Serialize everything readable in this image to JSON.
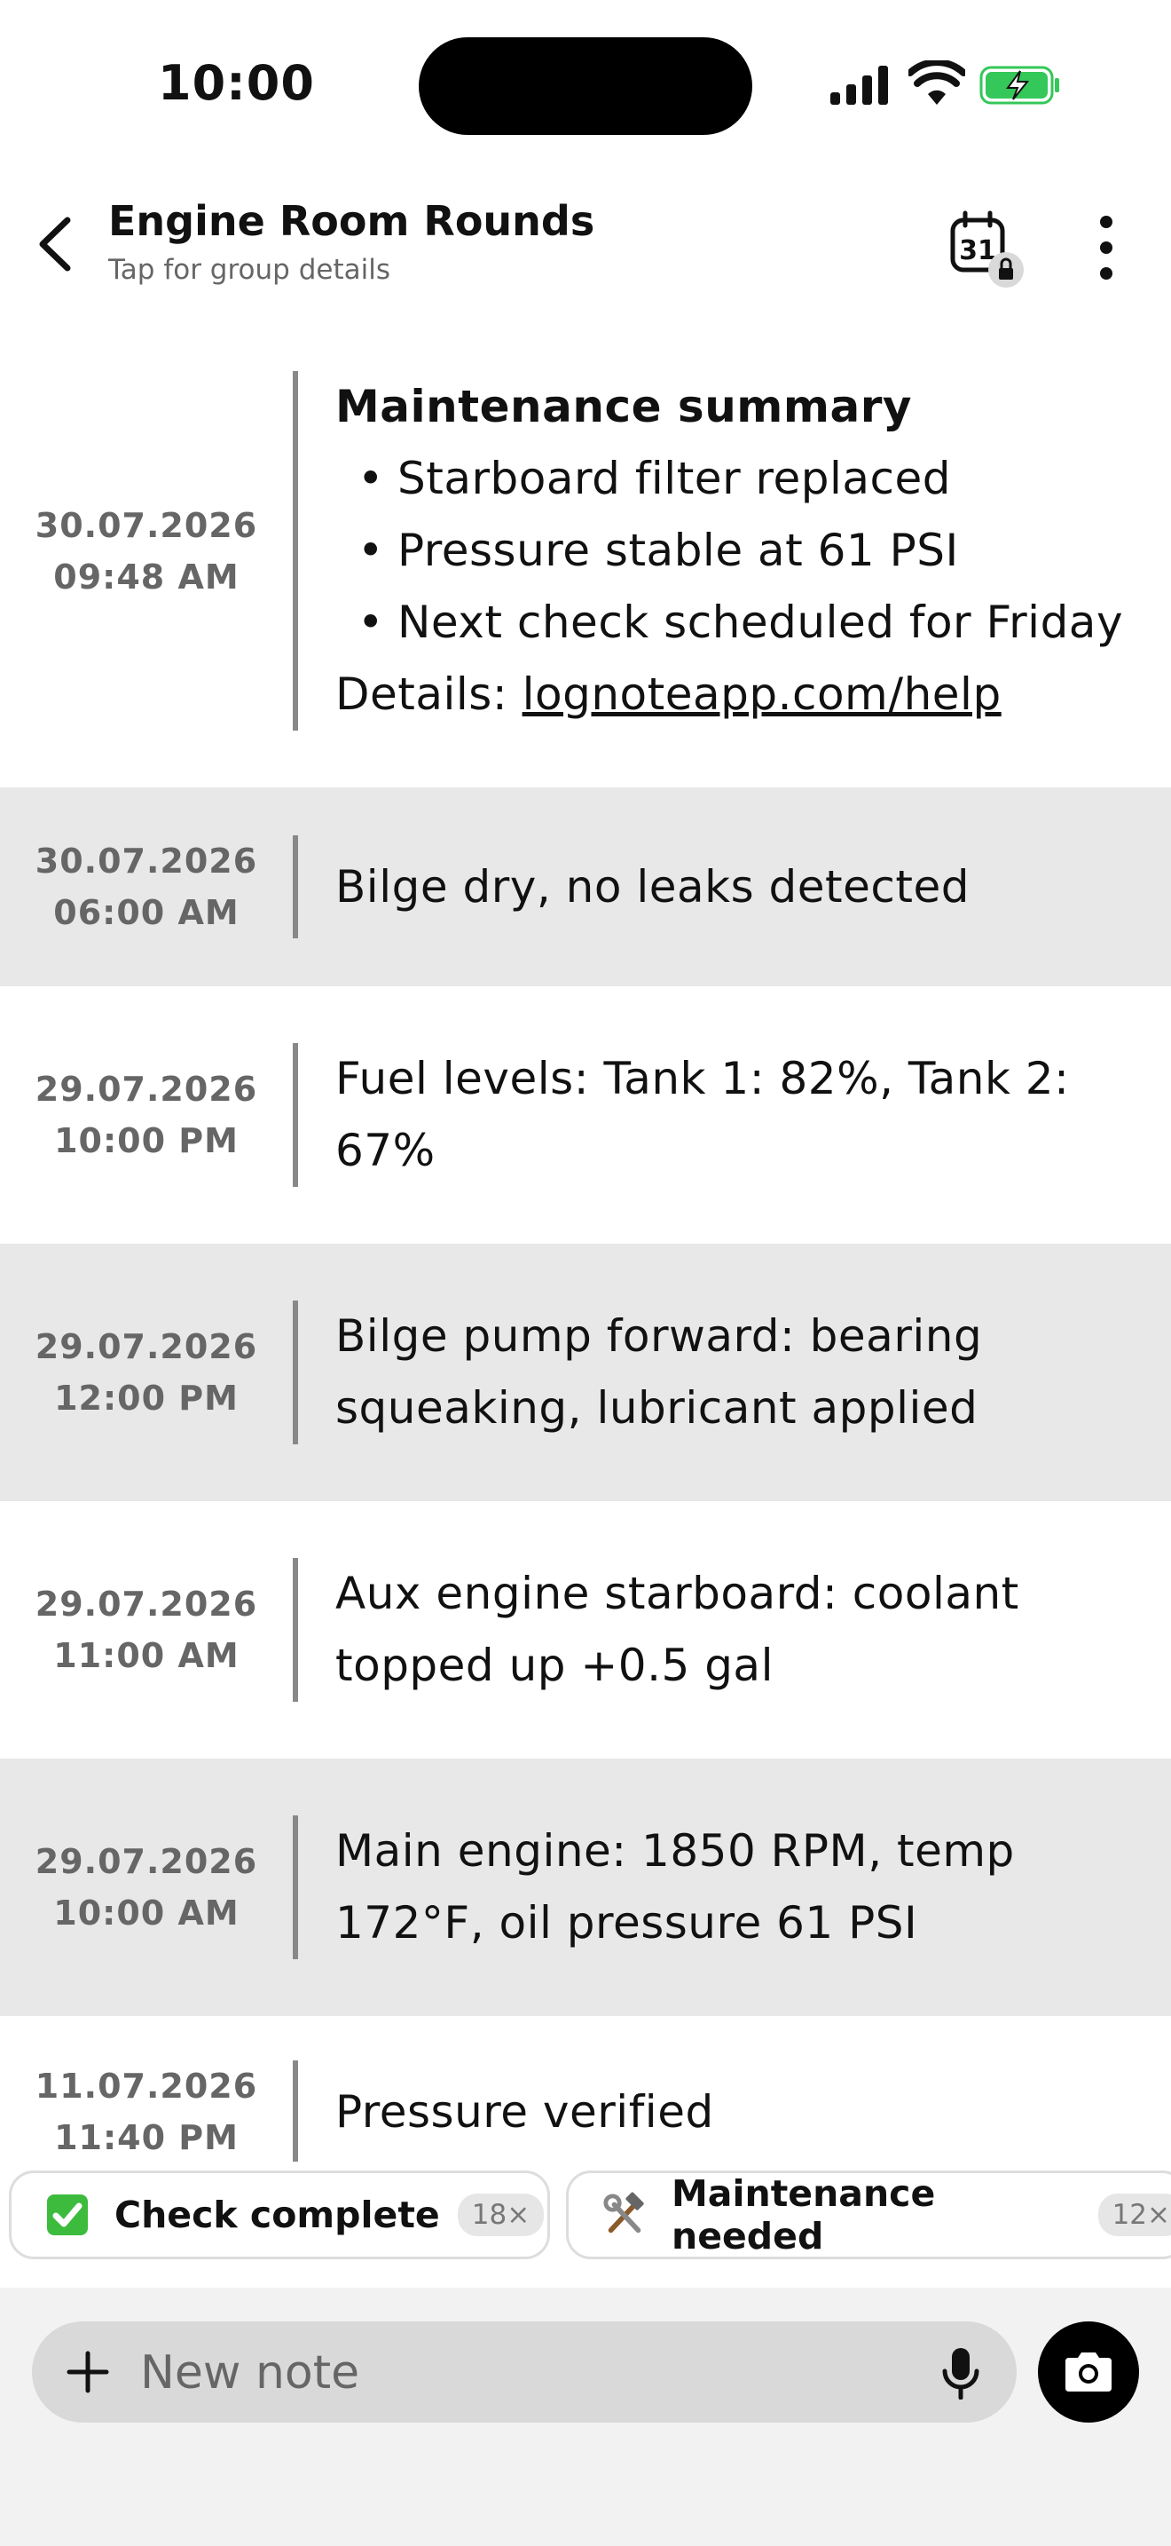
{
  "status_bar": {
    "time": "10:00"
  },
  "header": {
    "title": "Engine Room Rounds",
    "subtitle": "Tap for group details",
    "calendar_day": "31"
  },
  "notes": [
    {
      "date": "30.07.2026",
      "time": "09:48 AM",
      "summary_title": "Maintenance summary",
      "bullets": [
        "Starboard filter replaced",
        "Pressure stable at 61 PSI",
        "Next check scheduled for Friday"
      ],
      "details_label": "Details:",
      "details_link": "lognoteapp.com/help"
    },
    {
      "date": "30.07.2026",
      "time": "06:00 AM",
      "text": "Bilge dry, no leaks detected"
    },
    {
      "date": "29.07.2026",
      "time": "10:00 PM",
      "text": "Fuel levels: Tank 1: 82%, Tank 2: 67%"
    },
    {
      "date": "29.07.2026",
      "time": "12:00 PM",
      "text": "Bilge pump forward: bearing squeaking, lubricant applied"
    },
    {
      "date": "29.07.2026",
      "time": "11:00 AM",
      "text": "Aux engine starboard: coolant topped up +0.5 gal"
    },
    {
      "date": "29.07.2026",
      "time": "10:00 AM",
      "text": "Main engine: 1850 RPM, temp 172°F, oil pressure 61 PSI"
    },
    {
      "date": "11.07.2026",
      "time": "11:40 PM",
      "text": "Pressure verified"
    }
  ],
  "quick_reactions": [
    {
      "label": "Check complete",
      "count": "18×",
      "icon": "check-box-icon",
      "color": "#3dbb3d"
    },
    {
      "label": "Maintenance needed",
      "count": "12×",
      "icon": "hammer-wrench-icon"
    }
  ],
  "composer": {
    "placeholder": "New note"
  },
  "colors": {
    "battery_green": "#34c759",
    "shade_row": "#e8e8e8"
  }
}
